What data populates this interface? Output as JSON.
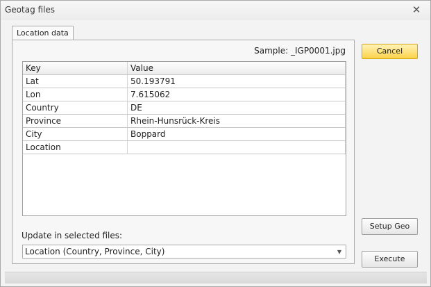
{
  "window": {
    "title": "Geotag files",
    "close_label": "✕"
  },
  "tabs": [
    {
      "label": "Location data"
    }
  ],
  "sample": {
    "text": "Sample: _IGP0001.jpg"
  },
  "grid": {
    "headers": [
      "Key",
      "Value"
    ],
    "rows": [
      {
        "key": "Lat",
        "value": "50.193791"
      },
      {
        "key": "Lon",
        "value": "7.615062"
      },
      {
        "key": "Country",
        "value": "DE"
      },
      {
        "key": "Province",
        "value": "Rhein-Hunsrück-Kreis"
      },
      {
        "key": "City",
        "value": "Boppard"
      },
      {
        "key": "Location",
        "value": ""
      }
    ]
  },
  "update": {
    "label": "Update in selected files:",
    "selected": "Location (Country, Province, City)"
  },
  "buttons": {
    "cancel": "Cancel",
    "setup_geo": "Setup Geo",
    "execute": "Execute"
  }
}
